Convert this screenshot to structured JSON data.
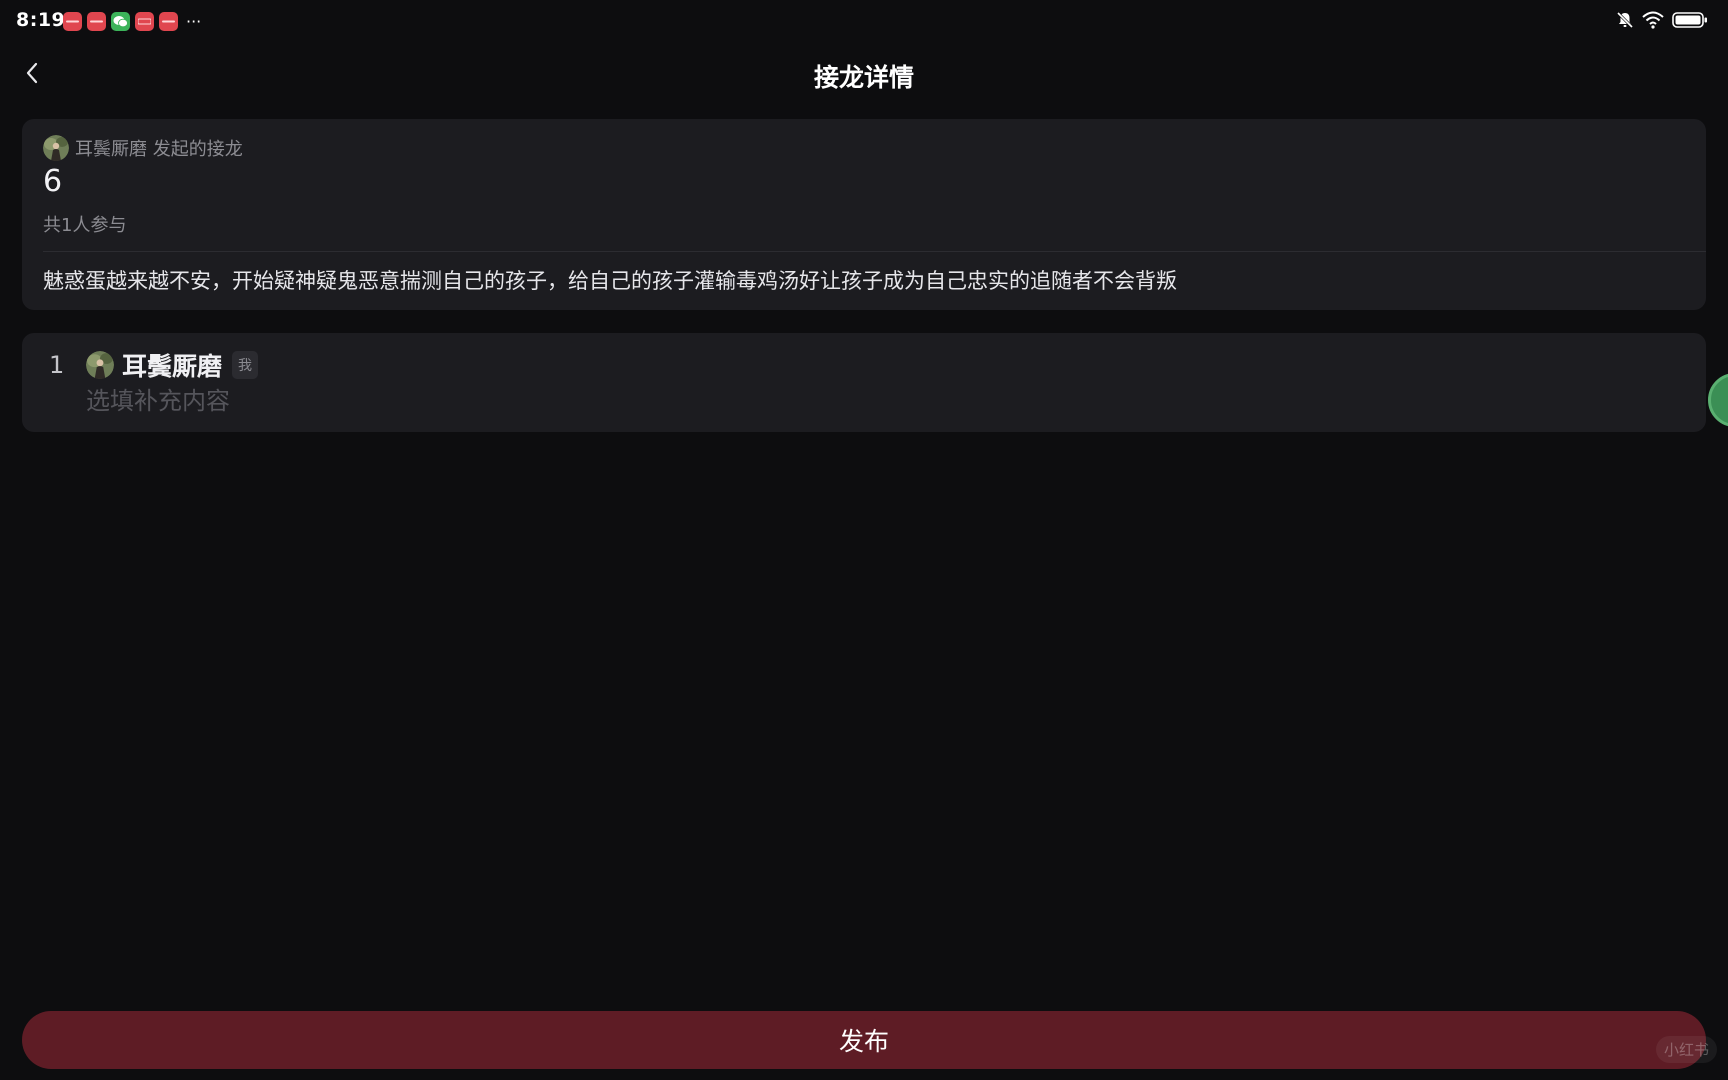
{
  "status_bar": {
    "time": "8:19",
    "notification_icons": [
      {
        "name": "app-notification-icon",
        "color": "#e0464f",
        "label": ""
      },
      {
        "name": "app-notification-icon",
        "color": "#e0464f",
        "label": ""
      },
      {
        "name": "wechat-icon",
        "color": "#3cb35a",
        "label": ""
      },
      {
        "name": "app-notification-icon",
        "color": "#e0464f",
        "label": ""
      },
      {
        "name": "app-notification-icon",
        "color": "#e0464f",
        "label": ""
      }
    ],
    "more": "···",
    "right_icons": [
      "mute-icon",
      "wifi-icon",
      "battery-icon"
    ]
  },
  "header": {
    "title": "接龙详情",
    "back_icon": "chevron-left-icon"
  },
  "summary": {
    "initiator": "耳鬓厮磨 发起的接龙",
    "count": "6",
    "participants": "共1人参与",
    "description": "魅惑蛋越来越不安，开始疑神疑鬼恶意揣测自己的孩子，给自己的孩子灌输毒鸡汤好让孩子成为自己忠实的追随者不会背叛"
  },
  "entries": [
    {
      "index": "1",
      "name": "耳鬓厮磨",
      "badge": "我",
      "value": "",
      "placeholder": "选填补充内容"
    }
  ],
  "footer": {
    "publish_label": "发布"
  },
  "colors": {
    "background": "#0d0d0f",
    "card": "#1c1c20",
    "publish": "#5e1c25",
    "muted_text": "#8c8c92"
  }
}
